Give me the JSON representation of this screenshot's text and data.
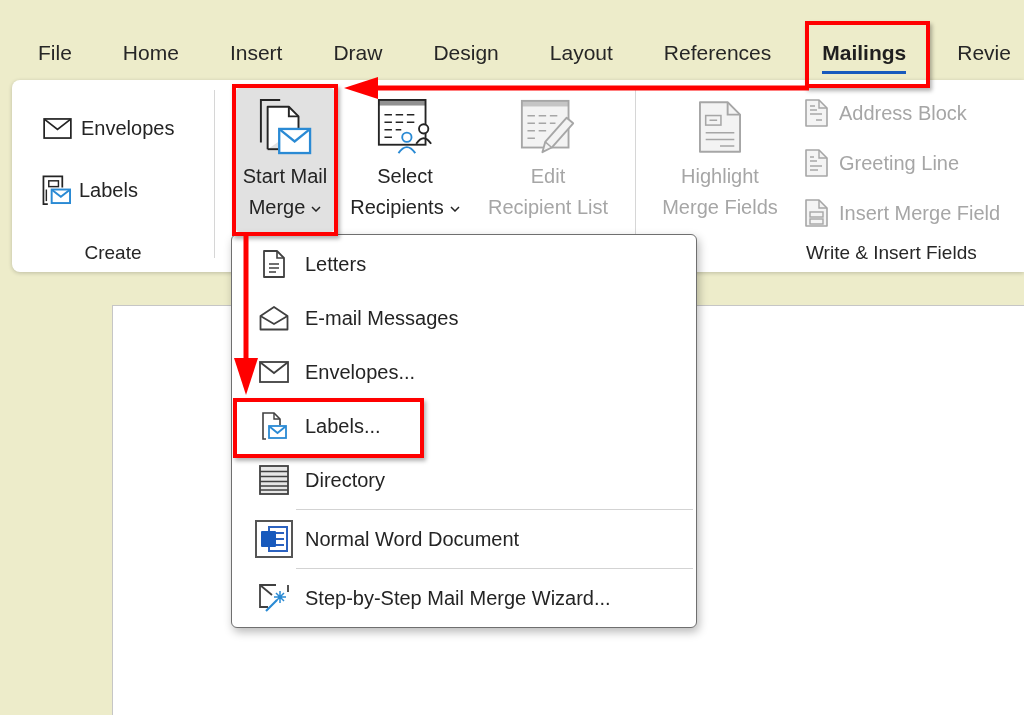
{
  "tabs": [
    {
      "label": "File",
      "selected": false,
      "highlighted": false
    },
    {
      "label": "Home",
      "selected": false,
      "highlighted": false
    },
    {
      "label": "Insert",
      "selected": false,
      "highlighted": false
    },
    {
      "label": "Draw",
      "selected": false,
      "highlighted": false
    },
    {
      "label": "Design",
      "selected": false,
      "highlighted": false
    },
    {
      "label": "Layout",
      "selected": false,
      "highlighted": false
    },
    {
      "label": "References",
      "selected": false,
      "highlighted": false
    },
    {
      "label": "Mailings",
      "selected": true,
      "highlighted": true
    },
    {
      "label": "Revie",
      "selected": false,
      "highlighted": false
    }
  ],
  "ribbon": {
    "groups": [
      {
        "label": "Create",
        "buttons": [
          {
            "kind": "small",
            "label": "Envelopes",
            "dropdown": false,
            "expanded": false,
            "disabled": false,
            "highlighted": false
          },
          {
            "kind": "small",
            "label": "Labels",
            "dropdown": false,
            "expanded": false,
            "disabled": false,
            "highlighted": false
          }
        ]
      },
      {
        "buttons": [
          {
            "kind": "large",
            "label": "Start Mail Merge",
            "dropdown": true,
            "expanded": true,
            "disabled": false,
            "highlighted": true
          },
          {
            "kind": "large",
            "label": "Select Recipients",
            "dropdown": true,
            "expanded": false,
            "disabled": false,
            "highlighted": false
          },
          {
            "kind": "large",
            "label": "Edit Recipient List",
            "dropdown": false,
            "expanded": false,
            "disabled": true,
            "highlighted": false
          }
        ]
      },
      {
        "label": "Write & Insert Fields",
        "buttons": [
          {
            "kind": "large",
            "label": "Highlight Merge Fields",
            "dropdown": false,
            "expanded": false,
            "disabled": true,
            "highlighted": false
          },
          {
            "kind": "small",
            "label": "Address Block",
            "dropdown": false,
            "expanded": false,
            "disabled": true,
            "highlighted": false
          },
          {
            "kind": "small",
            "label": "Greeting Line",
            "dropdown": false,
            "expanded": false,
            "disabled": true,
            "highlighted": false
          },
          {
            "kind": "small",
            "label": "Insert Merge Field",
            "dropdown": false,
            "expanded": false,
            "disabled": true,
            "highlighted": false
          }
        ]
      }
    ]
  },
  "menu": {
    "items": [
      {
        "kind": "item",
        "label": "Letters",
        "highlighted": false
      },
      {
        "kind": "item",
        "label": "E-mail Messages",
        "highlighted": false
      },
      {
        "kind": "item",
        "label": "Envelopes...",
        "highlighted": false
      },
      {
        "kind": "item",
        "label": "Labels...",
        "highlighted": true
      },
      {
        "kind": "item",
        "label": "Directory",
        "highlighted": false
      },
      {
        "kind": "separator"
      },
      {
        "kind": "item",
        "label": "Normal Word Document",
        "highlighted": false
      },
      {
        "kind": "separator"
      },
      {
        "kind": "item",
        "label": "Step-by-Step Mail Merge Wizard...",
        "highlighted": false
      }
    ]
  }
}
